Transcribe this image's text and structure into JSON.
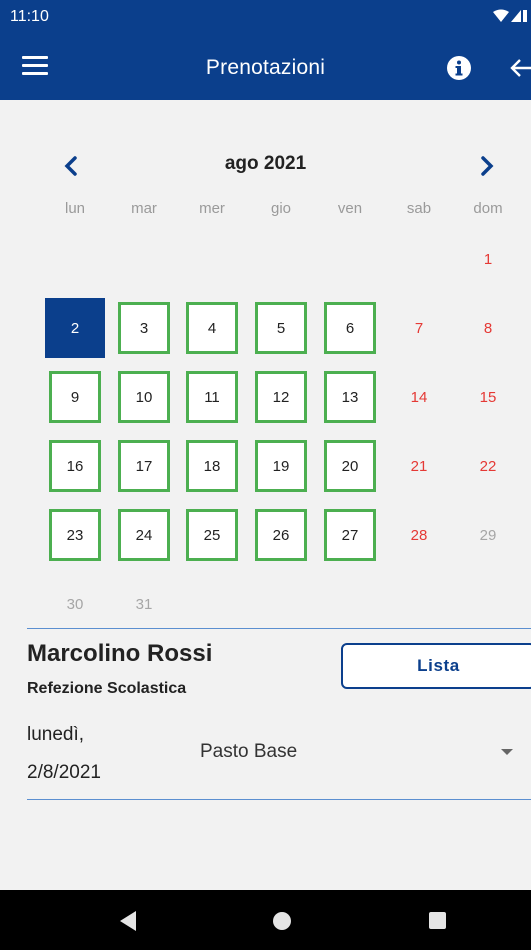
{
  "status": {
    "time": "11:10"
  },
  "appbar": {
    "title": "Prenotazioni",
    "icons": [
      "menu-icon",
      "info-icon",
      "arrow-left-icon"
    ]
  },
  "calendar": {
    "month_label": "ago 2021",
    "weekdays": [
      "lun",
      "mar",
      "mer",
      "gio",
      "ven",
      "sab",
      "dom"
    ],
    "days": [
      {
        "label": "1",
        "kind": "weekend"
      },
      {
        "label": "2",
        "kind": "selected"
      },
      {
        "label": "3",
        "kind": "bookable"
      },
      {
        "label": "4",
        "kind": "bookable"
      },
      {
        "label": "5",
        "kind": "bookable"
      },
      {
        "label": "6",
        "kind": "bookable"
      },
      {
        "label": "7",
        "kind": "weekend"
      },
      {
        "label": "8",
        "kind": "weekend"
      },
      {
        "label": "9",
        "kind": "bookable"
      },
      {
        "label": "10",
        "kind": "bookable"
      },
      {
        "label": "11",
        "kind": "bookable"
      },
      {
        "label": "12",
        "kind": "bookable"
      },
      {
        "label": "13",
        "kind": "bookable"
      },
      {
        "label": "14",
        "kind": "weekend"
      },
      {
        "label": "15",
        "kind": "weekend"
      },
      {
        "label": "16",
        "kind": "bookable"
      },
      {
        "label": "17",
        "kind": "bookable"
      },
      {
        "label": "18",
        "kind": "bookable"
      },
      {
        "label": "19",
        "kind": "bookable"
      },
      {
        "label": "20",
        "kind": "bookable"
      },
      {
        "label": "21",
        "kind": "weekend"
      },
      {
        "label": "22",
        "kind": "weekend"
      },
      {
        "label": "23",
        "kind": "bookable"
      },
      {
        "label": "24",
        "kind": "bookable"
      },
      {
        "label": "25",
        "kind": "bookable"
      },
      {
        "label": "26",
        "kind": "bookable"
      },
      {
        "label": "27",
        "kind": "bookable"
      },
      {
        "label": "28",
        "kind": "weekend"
      },
      {
        "label": "29",
        "kind": "other"
      },
      {
        "label": "30",
        "kind": "other"
      },
      {
        "label": "31",
        "kind": "other"
      }
    ]
  },
  "booking": {
    "person_name": "Marcolino Rossi",
    "service": "Refezione Scolastica",
    "lista_label": "Lista",
    "date_line1": "lunedì,",
    "date_line2": "2/8/2021",
    "meal_value": "Pasto Base"
  },
  "colors": {
    "primary": "#0b3f8c",
    "bookable_border": "#4caf50",
    "weekend_text": "#e53935",
    "muted_text": "#a6a6a6"
  }
}
